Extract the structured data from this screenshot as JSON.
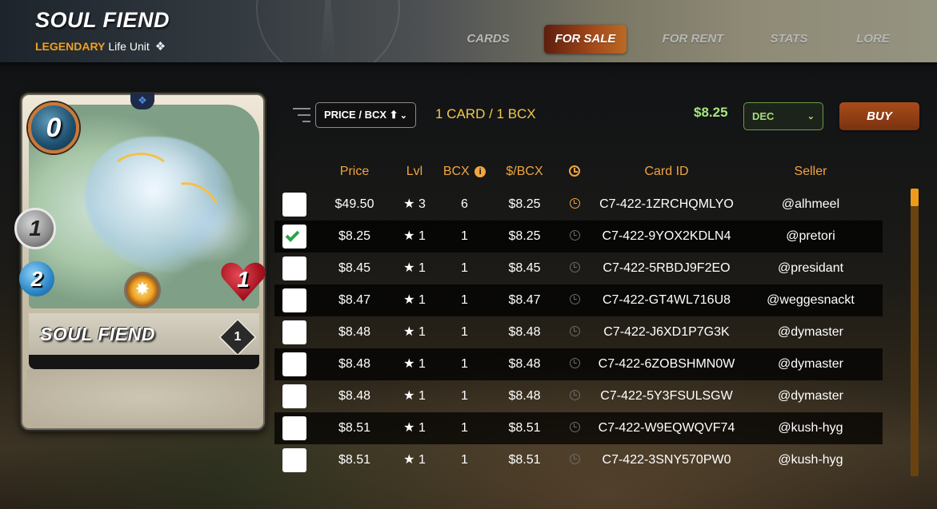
{
  "header": {
    "card_name": "SOUL FIEND",
    "rarity": "LEGENDARY",
    "type": "Life Unit",
    "type_icon": "life-element-icon",
    "nav": [
      {
        "label": "CARDS",
        "active": false
      },
      {
        "label": "FOR SALE",
        "active": true
      },
      {
        "label": "FOR RENT",
        "active": false
      },
      {
        "label": "STATS",
        "active": false
      },
      {
        "label": "LORE",
        "active": false
      }
    ]
  },
  "card": {
    "name": "SOUL FIEND",
    "mana": "0",
    "attack": "1",
    "speed": "2",
    "health": "1",
    "level": "1"
  },
  "controls": {
    "sort": "PRICE / BCX ⬆",
    "count": "1 CARD / 1 BCX",
    "price": "$8.25",
    "order": "DEC",
    "buy": "BUY"
  },
  "table": {
    "headers": {
      "price": "Price",
      "lvl": "Lvl",
      "bcx": "BCX",
      "per_bcx": "$/BCX",
      "card_id": "Card ID",
      "seller": "Seller"
    },
    "rows": [
      {
        "checked": false,
        "price": "$49.50",
        "lvl": "★ 3",
        "bcx": "6",
        "per_bcx": "$8.25",
        "card_id": "C7-422-1ZRCHQMLYO",
        "seller": "@alhmeel"
      },
      {
        "checked": true,
        "price": "$8.25",
        "lvl": "★ 1",
        "bcx": "1",
        "per_bcx": "$8.25",
        "card_id": "C7-422-9YOX2KDLN4",
        "seller": "@pretori"
      },
      {
        "checked": false,
        "price": "$8.45",
        "lvl": "★ 1",
        "bcx": "1",
        "per_bcx": "$8.45",
        "card_id": "C7-422-5RBDJ9F2EO",
        "seller": "@presidant"
      },
      {
        "checked": false,
        "price": "$8.47",
        "lvl": "★ 1",
        "bcx": "1",
        "per_bcx": "$8.47",
        "card_id": "C7-422-GT4WL716U8",
        "seller": "@weggesnackt"
      },
      {
        "checked": false,
        "price": "$8.48",
        "lvl": "★ 1",
        "bcx": "1",
        "per_bcx": "$8.48",
        "card_id": "C7-422-J6XD1P7G3K",
        "seller": "@dymaster"
      },
      {
        "checked": false,
        "price": "$8.48",
        "lvl": "★ 1",
        "bcx": "1",
        "per_bcx": "$8.48",
        "card_id": "C7-422-6ZOBSHMN0W",
        "seller": "@dymaster"
      },
      {
        "checked": false,
        "price": "$8.48",
        "lvl": "★ 1",
        "bcx": "1",
        "per_bcx": "$8.48",
        "card_id": "C7-422-5Y3FSULSGW",
        "seller": "@dymaster"
      },
      {
        "checked": false,
        "price": "$8.51",
        "lvl": "★ 1",
        "bcx": "1",
        "per_bcx": "$8.51",
        "card_id": "C7-422-W9EQWQVF74",
        "seller": "@kush-hyg"
      },
      {
        "checked": false,
        "price": "$8.51",
        "lvl": "★ 1",
        "bcx": "1",
        "per_bcx": "$8.51",
        "card_id": "C7-422-3SNY570PW0",
        "seller": "@kush-hyg"
      }
    ]
  },
  "colors": {
    "accent_orange": "#f0a540",
    "price_green": "#a6e87c",
    "count_yellow": "#f2c94c",
    "rarity_orange": "#f0a020",
    "buy_brown": "#a84c1a"
  }
}
